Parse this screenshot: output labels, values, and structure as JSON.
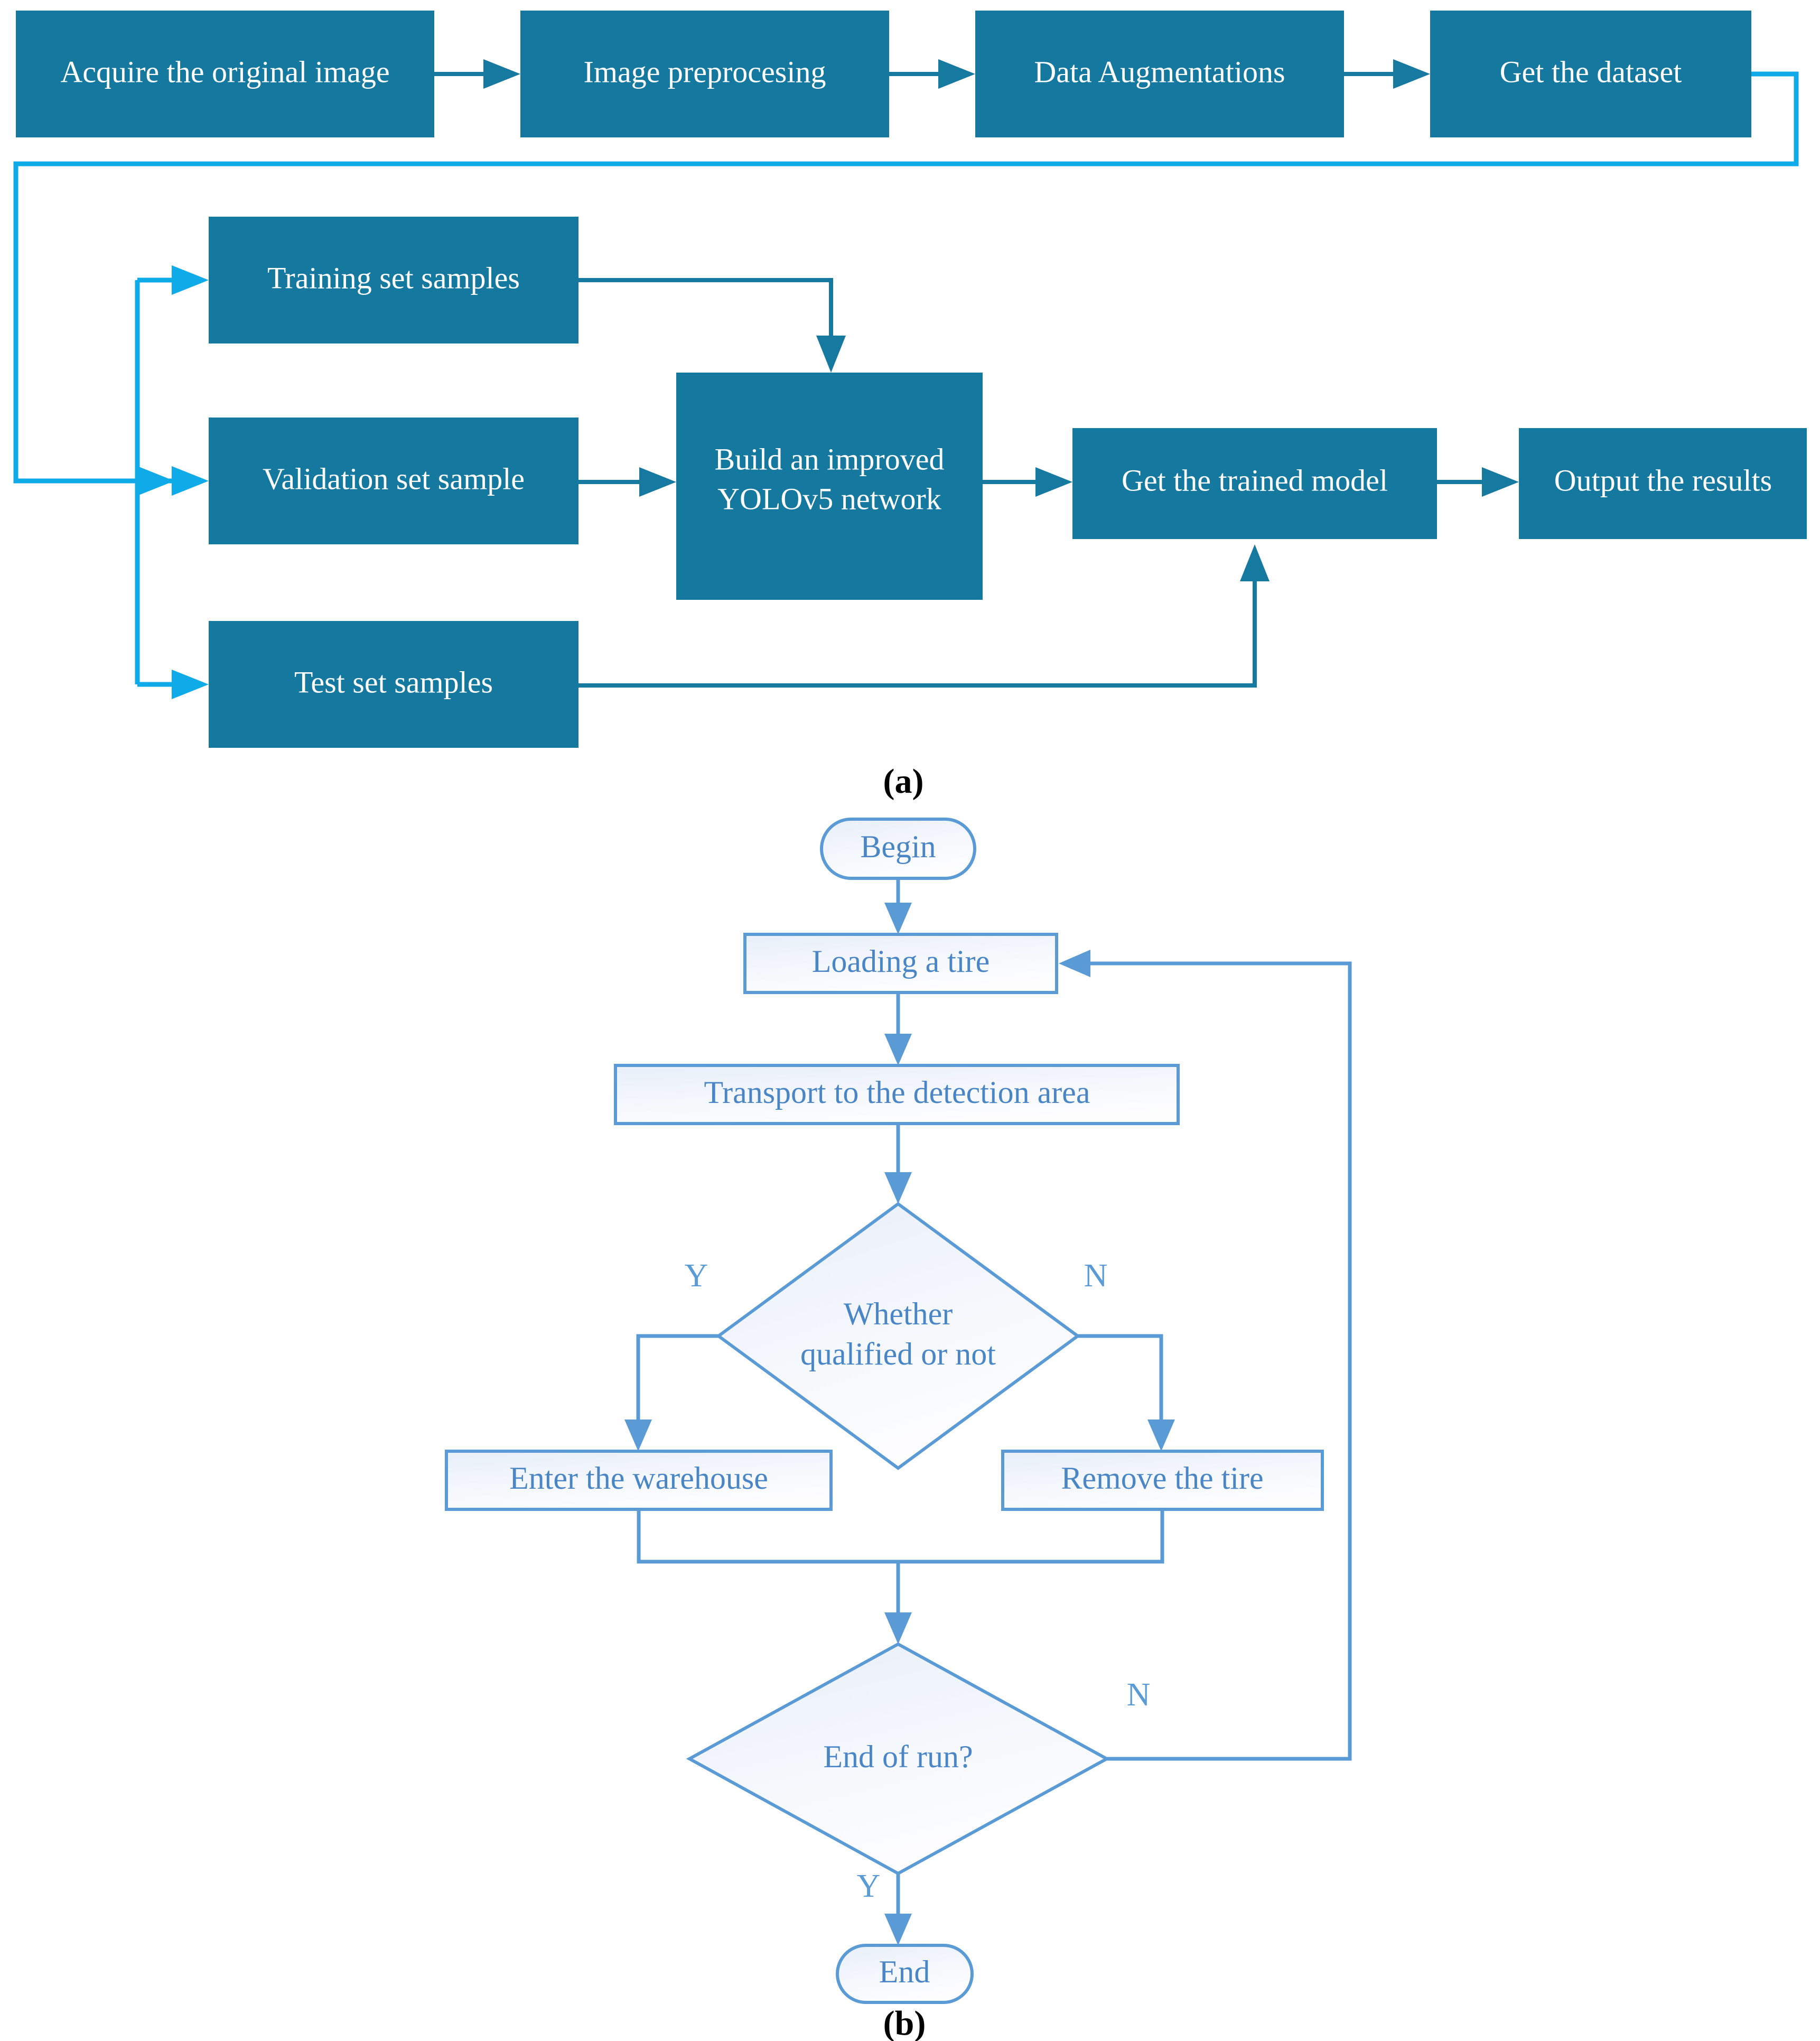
{
  "colors": {
    "process_box_fill": "#14789F",
    "process_text": "#FFFFFF",
    "connector_dark": "#1579A0",
    "connector_light": "#0FAAE8",
    "flow_stroke": "#5B9BD5",
    "flow_text": "#4A86C5",
    "flow_box_fill_start": "#EDF2FA",
    "flow_box_fill_end": "#FBFCFE",
    "background": "#FFFFFF"
  },
  "panel_a": {
    "label": "(a)",
    "pipeline_boxes": [
      {
        "id": "acquire",
        "label": "Acquire the original image"
      },
      {
        "id": "preprocess",
        "label": "Image preprocesing"
      },
      {
        "id": "augment",
        "label": "Data Augmentations"
      },
      {
        "id": "dataset",
        "label": "Get the dataset"
      }
    ],
    "split_boxes": [
      {
        "id": "train",
        "label": "Training set samples"
      },
      {
        "id": "val",
        "label": "Validation set sample"
      },
      {
        "id": "test",
        "label": "Test set samples"
      }
    ],
    "model_boxes": [
      {
        "id": "build",
        "label": "Build an improved\nYOLOv5 network",
        "line1": "Build an improved",
        "line2": "YOLOv5 network"
      },
      {
        "id": "trained",
        "label": "Get the trained model"
      },
      {
        "id": "output",
        "label": "Output the results"
      }
    ]
  },
  "panel_b": {
    "label": "(b)",
    "nodes": [
      {
        "id": "begin",
        "shape": "terminator",
        "label": "Begin"
      },
      {
        "id": "loading",
        "shape": "process",
        "label": "Loading a tire"
      },
      {
        "id": "transport",
        "shape": "process",
        "label": "Transport to the detection area"
      },
      {
        "id": "qualified",
        "shape": "decision",
        "label": "Whether qualified or not",
        "line1": "Whether",
        "line2": "qualified or not"
      },
      {
        "id": "warehouse",
        "shape": "process",
        "label": "Enter the warehouse"
      },
      {
        "id": "remove",
        "shape": "process",
        "label": "Remove the tire"
      },
      {
        "id": "endrun",
        "shape": "decision",
        "label": "End of run?"
      },
      {
        "id": "end",
        "shape": "terminator",
        "label": "End"
      }
    ],
    "branch_labels": {
      "qualified_yes": "Y",
      "qualified_no": "N",
      "endrun_no": "N",
      "endrun_yes": "Y"
    }
  }
}
